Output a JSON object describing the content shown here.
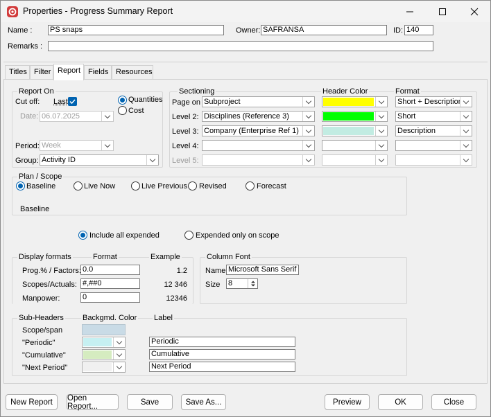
{
  "window": {
    "title": "Properties - Progress Summary Report",
    "minimize": "—",
    "maximize": "☐",
    "close": "✕"
  },
  "header": {
    "name_label": "Name :",
    "name_value": "PS snaps",
    "owner_label": "Owner:",
    "owner_value": "SAFRANSA",
    "id_label": "ID:",
    "id_value": "140",
    "remarks_label": "Remarks :",
    "remarks_value": ""
  },
  "tabs": [
    {
      "label": "Titles"
    },
    {
      "label": "Filter"
    },
    {
      "label": "Report"
    },
    {
      "label": "Fields"
    },
    {
      "label": "Resources"
    }
  ],
  "report_on": {
    "title": "Report On",
    "cutoff_label": "Cut off:",
    "last_label": "Last",
    "date_label": "Date:",
    "date_value": "06.07.2025",
    "quantities_label": "Quantities",
    "cost_label": "Cost",
    "period_label": "Period:",
    "period_value": "Week",
    "group_label": "Group:",
    "group_value": "Activity ID"
  },
  "sectioning": {
    "title": "Sectioning",
    "header_color_title": "Header Color",
    "format_title": "Format",
    "rows": [
      {
        "label": "Page on",
        "value": "Subproject",
        "color": "#ffff00",
        "format": "Short + Description"
      },
      {
        "label": "Level 2:",
        "value": "Disciplines (Reference 3)",
        "color": "#00ff00",
        "format": "Short"
      },
      {
        "label": "Level 3:",
        "value": "Company (Enterprise Ref 1)",
        "color": "#c2ece2",
        "format": "Description"
      },
      {
        "label": "Level 4:",
        "value": "",
        "color": "",
        "format": ""
      },
      {
        "label": "Level 5:",
        "value": "",
        "color": "",
        "format": ""
      }
    ]
  },
  "plan_scope": {
    "title": "Plan / Scope",
    "options": [
      "Baseline",
      "Live Now",
      "Live Previous",
      "Revised",
      "Forecast"
    ],
    "selected": "Baseline",
    "caption": "Baseline"
  },
  "expended": {
    "include_label": "Include all expended",
    "scope_label": "Expended only on scope"
  },
  "display_formats": {
    "title": "Display formats",
    "format_header": "Format",
    "example_header": "Example",
    "rows": [
      {
        "label": "Prog.% / Factors:",
        "format": "0.0",
        "example": "1.2"
      },
      {
        "label": "Scopes/Actuals:",
        "format": "#,##0",
        "example": "12 346"
      },
      {
        "label": "Manpower:",
        "format": "0",
        "example": "12346"
      }
    ]
  },
  "column_font": {
    "title": "Column Font",
    "name_label": "Name",
    "name_value": "Microsoft Sans Serif",
    "size_label": "Size",
    "size_value": "8"
  },
  "sub_headers": {
    "title": "Sub-Headers",
    "color_header": "Backgmd. Color",
    "label_header": "Label",
    "rows": [
      {
        "label": "Scope/span",
        "color": "#c9dbe6",
        "value": ""
      },
      {
        "label": "\"Periodic\"",
        "color": "#c6f0f2",
        "value": "Periodic"
      },
      {
        "label": "\"Cumulative\"",
        "color": "#d5ecc0",
        "value": "Cumulative"
      },
      {
        "label": "\"Next Period\"",
        "color": "#f0f0f0",
        "value": "Next Period"
      }
    ]
  },
  "buttons": {
    "new_report": "New Report",
    "open_report": "Open Report...",
    "save": "Save",
    "save_as": "Save As...",
    "preview": "Preview",
    "ok": "OK",
    "close": "Close"
  },
  "colors": {
    "accent": "#0063b1",
    "app_icon": "#d23b3b"
  }
}
